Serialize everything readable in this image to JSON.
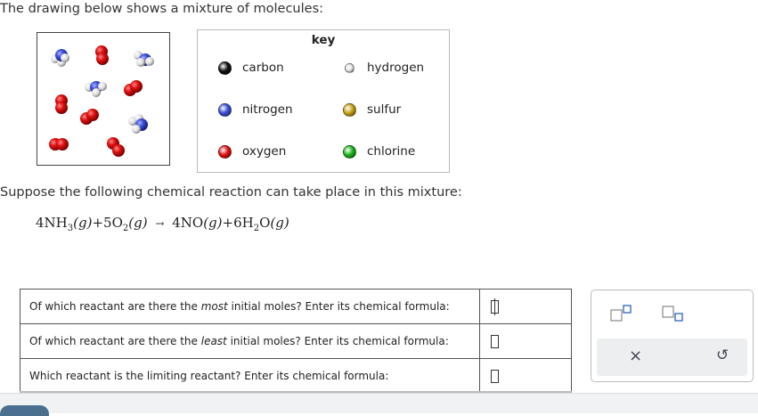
{
  "intro": "The drawing below shows a mixture of molecules:",
  "key": {
    "title": "key",
    "items": [
      {
        "label": "carbon",
        "color": "#111111"
      },
      {
        "label": "hydrogen",
        "color": "#e8e8e8"
      },
      {
        "label": "nitrogen",
        "color": "#3b4fd8"
      },
      {
        "label": "sulfur",
        "color": "#c9a316"
      },
      {
        "label": "oxygen",
        "color": "#e01010"
      },
      {
        "label": "chlorine",
        "color": "#1bb51b"
      }
    ]
  },
  "suppose": "Suppose the following chemical reaction can take place in this mixture:",
  "equation": {
    "r1_coef": "4",
    "r1_formula": "NH",
    "r1_sub": "3",
    "r1_state": "(g)",
    "plus1": "+",
    "r2_coef": "5",
    "r2_formula": "O",
    "r2_sub": "2",
    "r2_state": "(g)",
    "arrow": "→",
    "p1_coef": "4",
    "p1_formula": "NO",
    "p1_state": "(g)",
    "plus2": "+",
    "p2_coef": "6",
    "p2_formula": "H",
    "p2_sub": "2",
    "p2_formula2": "O",
    "p2_state": "(g)"
  },
  "questions": [
    {
      "pre": "Of which reactant are there the ",
      "em": "most",
      "post": " initial moles? Enter its chemical formula:"
    },
    {
      "pre": "Of which reactant are there the ",
      "em": "least",
      "post": " initial moles? Enter its chemical formula:"
    },
    {
      "pre": "Which reactant is the limiting reactant? Enter its chemical formula:",
      "em": "",
      "post": ""
    }
  ],
  "toolbox": {
    "tools": [
      "superscript-tool",
      "subscript-tool"
    ],
    "clear": "×",
    "undo": "↺"
  }
}
